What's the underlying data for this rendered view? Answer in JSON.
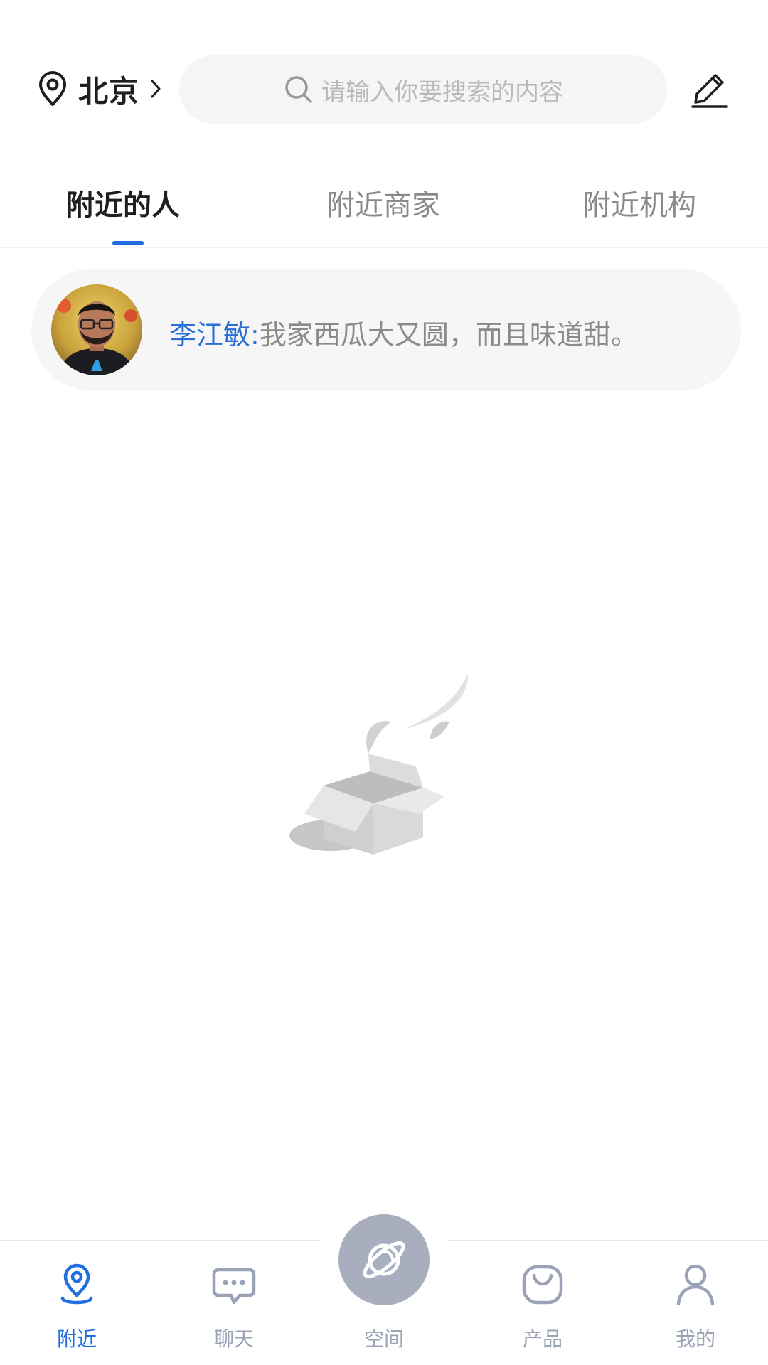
{
  "header": {
    "city": "北京",
    "search_placeholder": "请输入你要搜索的内容"
  },
  "tabs": [
    {
      "label": "附近的人",
      "active": true
    },
    {
      "label": "附近商家",
      "active": false
    },
    {
      "label": "附近机构",
      "active": false
    }
  ],
  "message": {
    "name": "李江敏",
    "separator": ":",
    "text": "我家西瓜大又圆，而且味道甜。"
  },
  "bottom_nav": {
    "items": [
      {
        "label": "附近",
        "icon": "location-icon",
        "active": true
      },
      {
        "label": "聊天",
        "icon": "chat-icon",
        "active": false
      },
      {
        "label": "空间",
        "icon": "planet-icon",
        "active": false
      },
      {
        "label": "产品",
        "icon": "bag-icon",
        "active": false
      },
      {
        "label": "我的",
        "icon": "person-icon",
        "active": false
      }
    ]
  },
  "colors": {
    "accent": "#1f6fe0",
    "inactive": "#9aa2b6",
    "name_blue": "#2a6fd6",
    "card_bg": "#f6f6f6"
  }
}
